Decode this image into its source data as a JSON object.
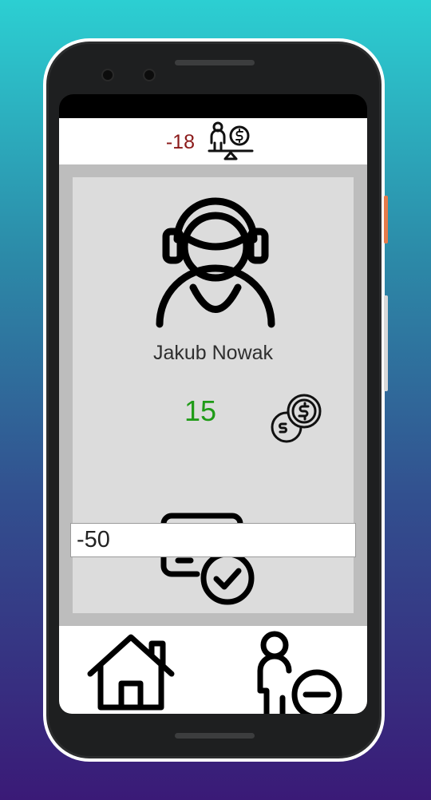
{
  "header": {
    "balance": "-18",
    "balance_icon": "balance-scale-person-dollar-icon"
  },
  "profile": {
    "avatar_icon": "user-headphones-icon",
    "name": "Jakub Nowak",
    "points": "15",
    "points_color": "#1f9b17",
    "coins_icon": "coins-dollar-icon"
  },
  "amount_field": {
    "value": "-50"
  },
  "confirm": {
    "icon": "payment-card-check-icon"
  },
  "bottom_nav": {
    "items": [
      {
        "icon": "home-icon"
      },
      {
        "icon": "remove-user-icon"
      }
    ]
  },
  "colors": {
    "balance_negative": "#8b1a1a",
    "card_background": "#dcdcdc",
    "content_background": "#bdbdbd"
  }
}
